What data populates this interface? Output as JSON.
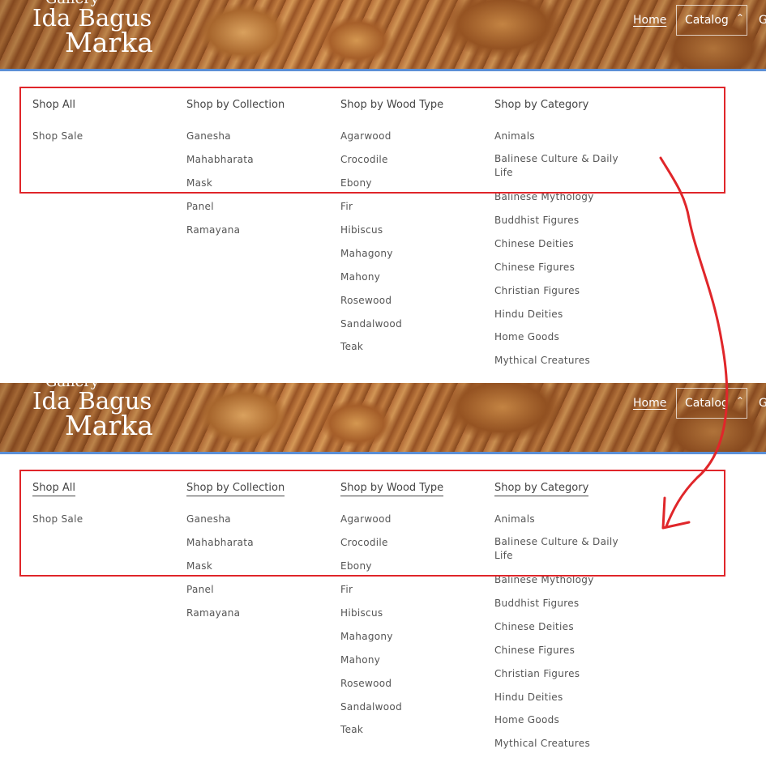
{
  "logo": {
    "line1": "Gallery",
    "line2": "Ida Bagus",
    "line3": "Marka"
  },
  "nav": {
    "home": "Home",
    "catalog": "Catalog",
    "chevron": "^",
    "extra": "G"
  },
  "menu": {
    "shop_all": {
      "heading": "Shop All",
      "items": [
        "Shop Sale"
      ]
    },
    "collection": {
      "heading": "Shop by Collection",
      "items": [
        "Ganesha",
        "Mahabharata",
        "Mask",
        "Panel",
        "Ramayana"
      ]
    },
    "wood": {
      "heading": "Shop by Wood Type",
      "items": [
        "Agarwood",
        "Crocodile",
        "Ebony",
        "Fir",
        "Hibiscus",
        "Mahagony",
        "Mahony",
        "Rosewood",
        "Sandalwood",
        "Teak"
      ]
    },
    "category": {
      "heading": "Shop by Category",
      "items": [
        "Animals",
        "Balinese Culture & Daily Life",
        "Balinese Mythology",
        "Buddhist Figures",
        "Chinese Deities",
        "Chinese Figures",
        "Christian Figures",
        "Hindu Deities",
        "Home Goods",
        "Mythical Creatures"
      ]
    }
  },
  "colors": {
    "highlight": "#e0262a",
    "header_line": "#5b8fd6"
  }
}
